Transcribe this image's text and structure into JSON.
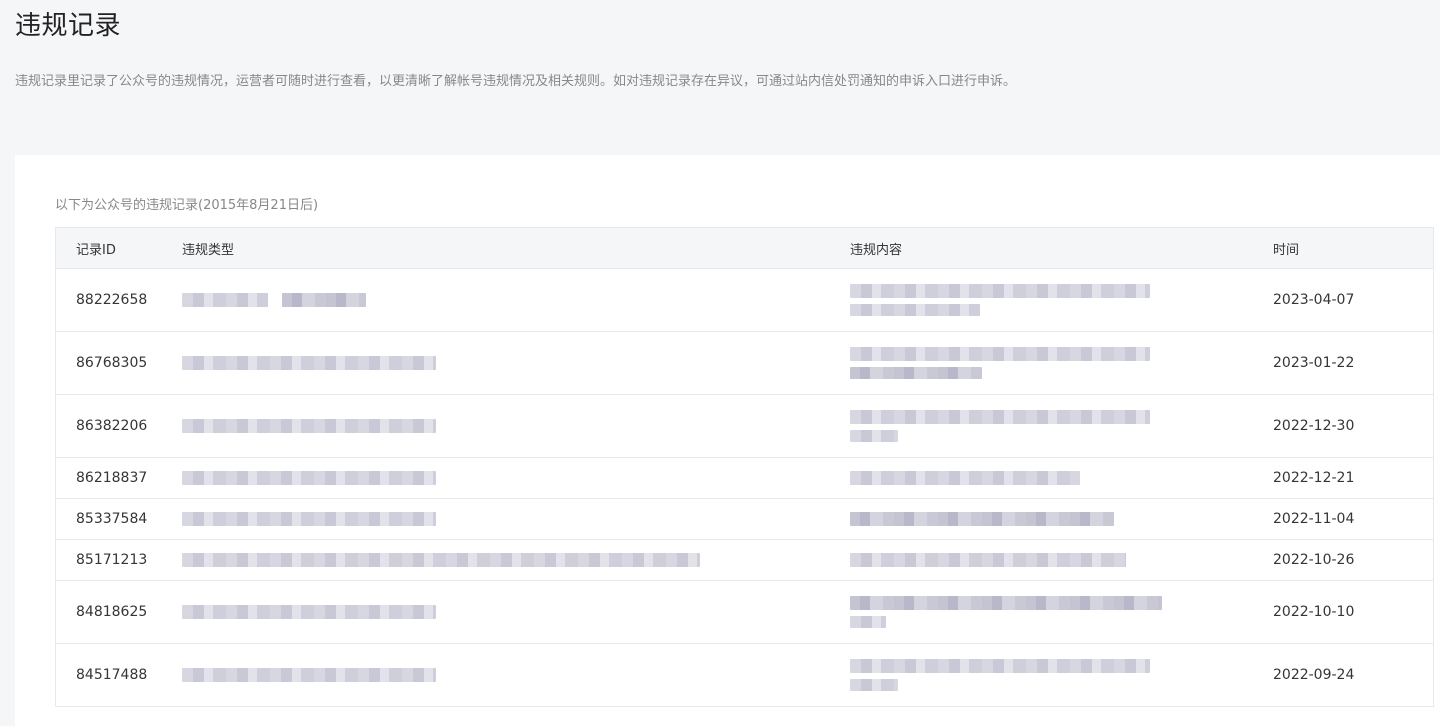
{
  "header": {
    "title": "违规记录",
    "description": "违规记录里记录了公众号的违规情况，运营者可随时进行查看，以更清晰了解帐号违规情况及相关规则。如对违规记录存在异议，可通过站内信处罚通知的申诉入口进行申诉。"
  },
  "table": {
    "caption": "以下为公众号的违规记录(2015年8月21日后)",
    "columns": {
      "id": "记录ID",
      "type": "违规类型",
      "content": "违规内容",
      "time": "时间"
    },
    "rows": [
      {
        "id": "88222658",
        "time": "2023-04-07"
      },
      {
        "id": "86768305",
        "time": "2023-01-22"
      },
      {
        "id": "86382206",
        "time": "2022-12-30"
      },
      {
        "id": "86218837",
        "time": "2022-12-21"
      },
      {
        "id": "85337584",
        "time": "2022-11-04"
      },
      {
        "id": "85171213",
        "time": "2022-10-26"
      },
      {
        "id": "84818625",
        "time": "2022-10-10"
      },
      {
        "id": "84517488",
        "time": "2022-09-24"
      }
    ]
  },
  "colors": {
    "page_background": "#f5f6f8",
    "card_background": "#ffffff",
    "header_row_background": "#f5f6f8",
    "border": "#e6e8eb",
    "muted_text": "#888888",
    "body_text": "#353535",
    "redaction": "#c8c8d6"
  }
}
